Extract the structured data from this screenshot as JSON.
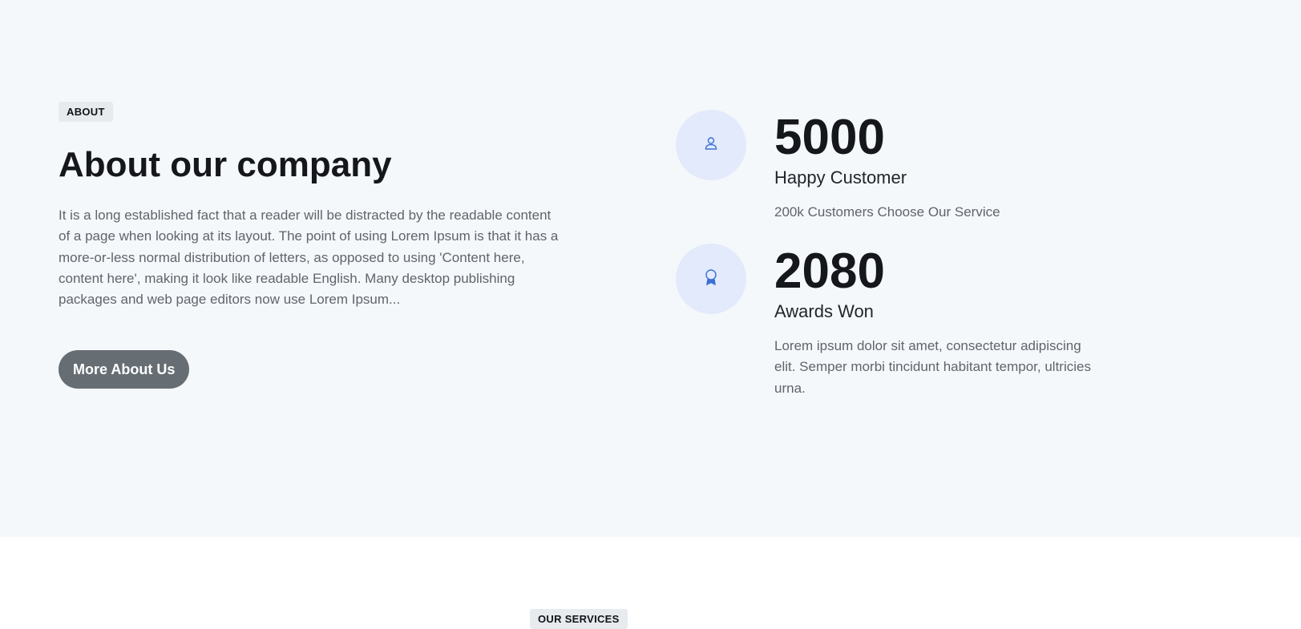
{
  "about": {
    "badge": "ABOUT",
    "title": "About our company",
    "text": "It is a long established fact that a reader will be distracted by the readable content of a page when looking at its layout. The point of using Lorem Ipsum is that it has a more-or-less normal distribution of letters, as opposed to using 'Content here, content here', making it look like readable English. Many desktop publishing packages and web page editors now use Lorem Ipsum...",
    "button_label": "More About Us"
  },
  "stats": [
    {
      "icon": "user-icon",
      "number": "5000",
      "label": "Happy Customer",
      "description": "200k Customers Choose Our Service"
    },
    {
      "icon": "award-icon",
      "number": "2080",
      "label": "Awards Won",
      "description": "Lorem ipsum dolor sit amet, consectetur adipiscing elit. Semper morbi tincidunt habitant tempor, ultricies urna."
    }
  ],
  "services": {
    "badge": "OUR SERVICES"
  },
  "colors": {
    "section_background": "#f5f8fb",
    "icon_circle": "#e2eafb",
    "icon_stroke": "#3b6fd4",
    "button_background": "#666d73",
    "badge_background": "#e7ebee"
  }
}
